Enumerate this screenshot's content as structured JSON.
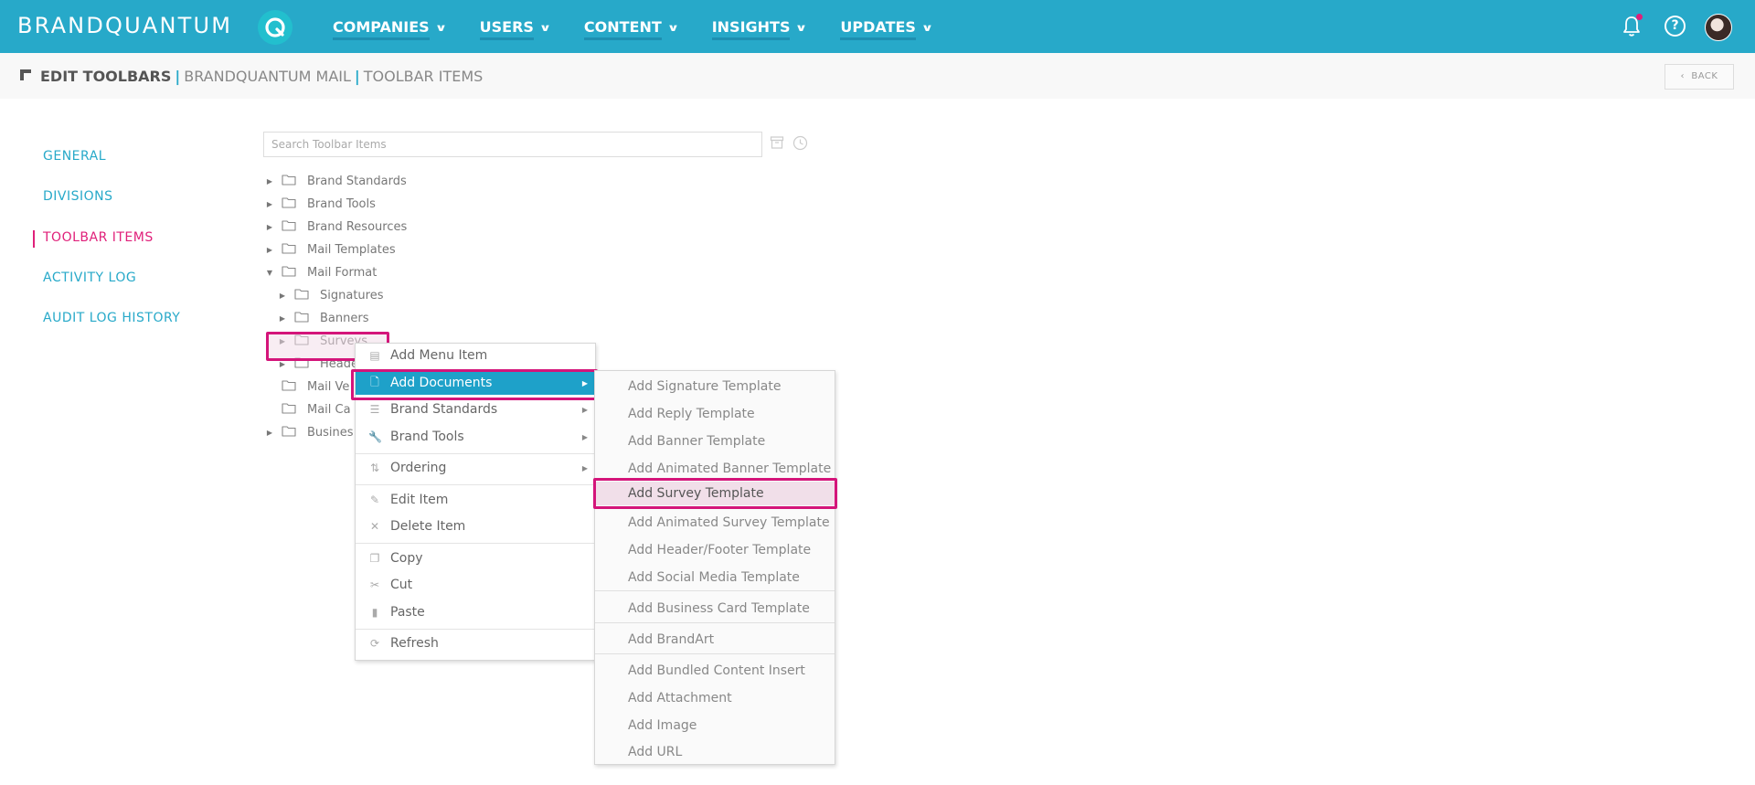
{
  "brand": {
    "name": "BRANDQUANTUM"
  },
  "nav": [
    {
      "label": "COMPANIES"
    },
    {
      "label": "USERS"
    },
    {
      "label": "CONTENT"
    },
    {
      "label": "INSIGHTS"
    },
    {
      "label": "UPDATES"
    }
  ],
  "header_icons": [
    "bell-icon",
    "help-icon",
    "avatar"
  ],
  "breadcrumb": {
    "title": "EDIT TOOLBARS",
    "crumb1": "BRANDQUANTUM MAIL",
    "crumb2": "TOOLBAR ITEMS",
    "separator": "|"
  },
  "back_button": {
    "label": "BACK",
    "icon": "chevron-left-icon"
  },
  "help_glyph": "?",
  "sidebar": {
    "items": [
      {
        "label": "GENERAL",
        "active": false
      },
      {
        "label": "DIVISIONS",
        "active": false
      },
      {
        "label": "TOOLBAR ITEMS",
        "active": true
      },
      {
        "label": "ACTIVITY LOG",
        "active": false
      },
      {
        "label": "AUDIT LOG HISTORY",
        "active": false
      }
    ]
  },
  "search": {
    "placeholder": "Search Toolbar Items",
    "value": ""
  },
  "tree": [
    {
      "label": "Brand Standards",
      "level": 0,
      "state": "collapsed"
    },
    {
      "label": "Brand Tools",
      "level": 0,
      "state": "collapsed"
    },
    {
      "label": "Brand Resources",
      "level": 0,
      "state": "collapsed"
    },
    {
      "label": "Mail Templates",
      "level": 0,
      "state": "collapsed"
    },
    {
      "label": "Mail Format",
      "level": 0,
      "state": "expanded"
    },
    {
      "label": "Signatures",
      "level": 1,
      "state": "collapsed"
    },
    {
      "label": "Banners",
      "level": 1,
      "state": "collapsed"
    },
    {
      "label": "Surveys",
      "level": 1,
      "state": "collapsed"
    },
    {
      "label": "Heade",
      "level": 1,
      "state": "collapsed"
    },
    {
      "label": "Mail Ve",
      "level": 0,
      "state": "leaf"
    },
    {
      "label": "Mail Ca",
      "level": 0,
      "state": "leaf"
    },
    {
      "label": "Busines",
      "level": 0,
      "state": "collapsed"
    }
  ],
  "context_menu": {
    "items": [
      {
        "label": "Add Menu Item",
        "icon": "menu-item-icon",
        "has_submenu": false
      },
      {
        "label": "Add Documents",
        "icon": "document-icon",
        "has_submenu": true,
        "selected": true
      },
      {
        "label": "Brand Standards",
        "icon": "sliders-icon",
        "has_submenu": true
      },
      {
        "label": "Brand Tools",
        "icon": "wrench-icon",
        "has_submenu": true
      },
      {
        "label": "Ordering",
        "icon": "sort-icon",
        "has_submenu": true
      },
      {
        "label": "Edit Item",
        "icon": "edit-icon",
        "has_submenu": false
      },
      {
        "label": "Delete Item",
        "icon": "close-icon",
        "has_submenu": false
      },
      {
        "label": "Copy",
        "icon": "copy-icon",
        "has_submenu": false
      },
      {
        "label": "Cut",
        "icon": "scissors-icon",
        "has_submenu": false
      },
      {
        "label": "Paste",
        "icon": "clipboard-icon",
        "has_submenu": false
      },
      {
        "label": "Refresh",
        "icon": "refresh-icon",
        "has_submenu": false
      }
    ]
  },
  "submenu": {
    "items": [
      {
        "label": "Add Signature Template"
      },
      {
        "label": "Add Reply Template"
      },
      {
        "label": "Add Banner Template"
      },
      {
        "label": "Add Animated Banner Template"
      },
      {
        "label": "Add Survey Template",
        "selected": true
      },
      {
        "label": "Add Animated Survey Template"
      },
      {
        "label": "Add Header/Footer Template"
      },
      {
        "label": "Add Social Media Template"
      },
      {
        "label": "Add Business Card Template"
      },
      {
        "label": "Add BrandArt"
      },
      {
        "label": "Add Bundled Content Insert"
      },
      {
        "label": "Add Attachment"
      },
      {
        "label": "Add Image"
      },
      {
        "label": "Add URL"
      }
    ]
  },
  "colors": {
    "topbar": "#27a9c9",
    "accent": "#e0207a",
    "menu_selected": "#1ea1c9",
    "highlight_outline": "#d4157a"
  }
}
